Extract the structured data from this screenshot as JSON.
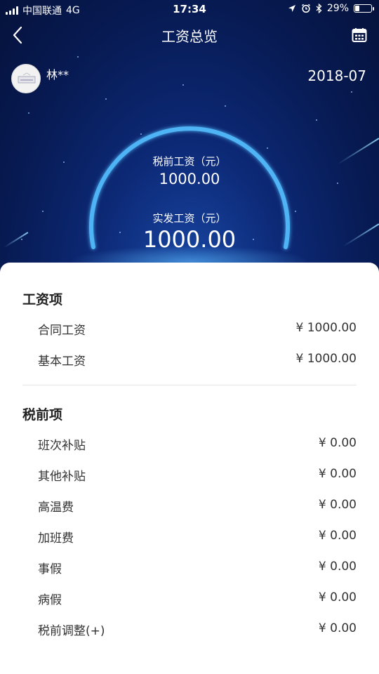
{
  "status_bar": {
    "carrier": "中国联通",
    "network": "4G",
    "time": "17:34",
    "battery": "29%",
    "battery_level": 0.29
  },
  "nav": {
    "title": "工资总览",
    "back_icon": "chevron-left-icon",
    "calendar_icon": "calendar-icon"
  },
  "user": {
    "name": "林**",
    "period": "2018-07"
  },
  "summary": {
    "pretax_label": "税前工资（元）",
    "pretax_value": "1000.00",
    "net_label": "实发工资（元）",
    "net_value": "1000.00"
  },
  "sections": [
    {
      "title": "工资项",
      "items": [
        {
          "label": "合同工资",
          "value": "¥ 1000.00"
        },
        {
          "label": "基本工资",
          "value": "¥ 1000.00"
        }
      ]
    },
    {
      "title": "税前项",
      "items": [
        {
          "label": "班次补贴",
          "value": "¥ 0.00"
        },
        {
          "label": "其他补贴",
          "value": "¥ 0.00"
        },
        {
          "label": "高温费",
          "value": "¥ 0.00"
        },
        {
          "label": "加班费",
          "value": "¥ 0.00"
        },
        {
          "label": "事假",
          "value": "¥ 0.00"
        },
        {
          "label": "病假",
          "value": "¥ 0.00"
        },
        {
          "label": "税前调整(+)",
          "value": "¥ 0.00"
        }
      ]
    }
  ],
  "colors": {
    "header_dark": "#071a52",
    "gauge_arc": "#4fb4f5",
    "text_primary": "#222222"
  }
}
